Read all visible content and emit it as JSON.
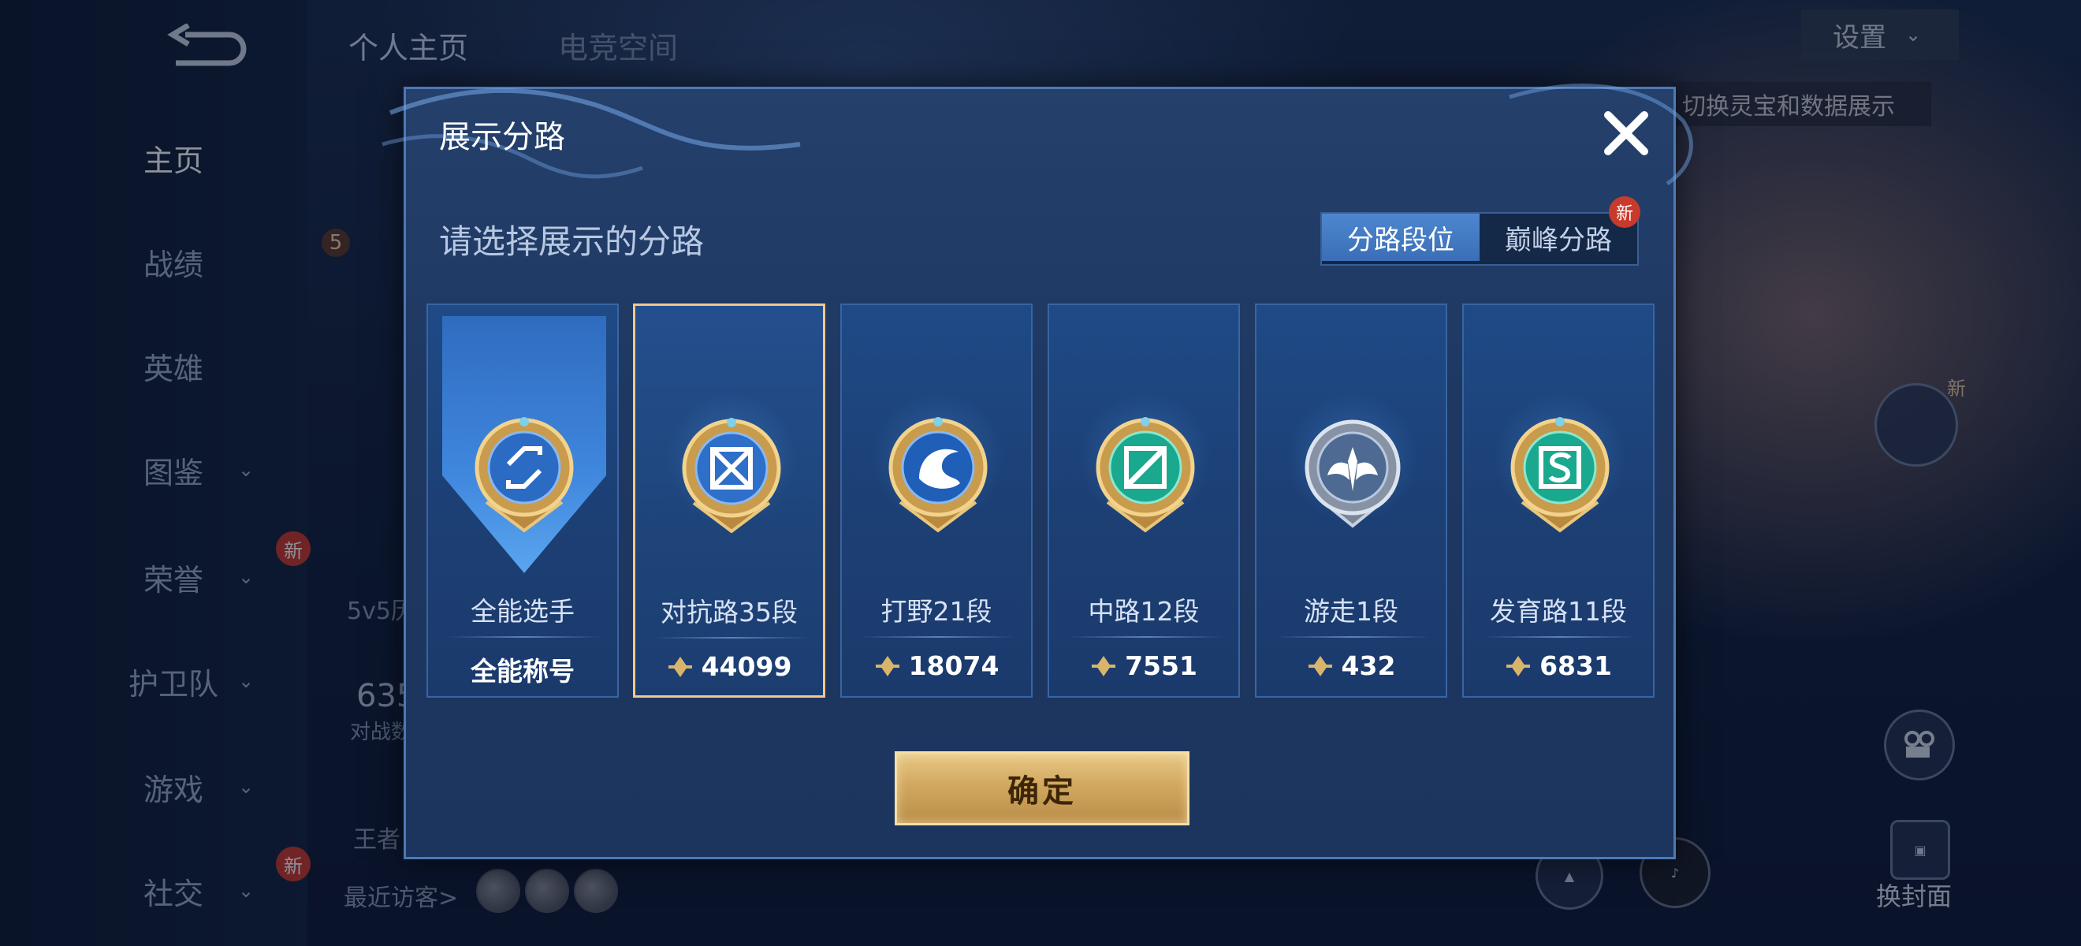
{
  "background": {
    "nav": {
      "items": [
        {
          "label": "主页",
          "has_chevron": false,
          "active": true,
          "new": false
        },
        {
          "label": "战绩",
          "has_chevron": false,
          "active": false,
          "new": false
        },
        {
          "label": "英雄",
          "has_chevron": false,
          "active": false,
          "new": false
        },
        {
          "label": "图鉴",
          "has_chevron": true,
          "active": false,
          "new": false
        },
        {
          "label": "荣誉",
          "has_chevron": true,
          "active": false,
          "new": true
        },
        {
          "label": "护卫队",
          "has_chevron": true,
          "active": false,
          "new": false
        },
        {
          "label": "游戏",
          "has_chevron": true,
          "active": false,
          "new": false
        },
        {
          "label": "社交",
          "has_chevron": true,
          "active": false,
          "new": true
        }
      ],
      "chevron": "⌄",
      "new_badge": "新"
    },
    "top_tabs": [
      "个人主页",
      "电竞空间"
    ],
    "settings": {
      "label": "设置",
      "chevron": "⌄"
    },
    "hint": "切换灵宝和数据展示",
    "fragments": {
      "level": "5",
      "mode": "5v5历",
      "count": "635",
      "count_label": "对战数",
      "king": "王者",
      "recent_visitors": "最近访客>",
      "side_new": "新",
      "cover_label": "换封面"
    }
  },
  "dialog": {
    "title": "展示分路",
    "close_icon": "close-icon",
    "subtitle": "请选择展示的分路",
    "segments": [
      {
        "label": "分路段位",
        "active": true,
        "new": false
      },
      {
        "label": "巅峰分路",
        "active": false,
        "new": true
      }
    ],
    "new_badge": "新",
    "cards": [
      {
        "name": "全能选手",
        "score": "全能称号",
        "selected": false,
        "badge": "all-round-badge-icon",
        "points_icon": false
      },
      {
        "name": "对抗路35段",
        "score": "44099",
        "selected": true,
        "badge": "clash-lane-badge-icon",
        "points_icon": true
      },
      {
        "name": "打野21段",
        "score": "18074",
        "selected": false,
        "badge": "jungle-badge-icon",
        "points_icon": true
      },
      {
        "name": "中路12段",
        "score": "7551",
        "selected": false,
        "badge": "mid-lane-badge-icon",
        "points_icon": true
      },
      {
        "name": "游走1段",
        "score": "432",
        "selected": false,
        "badge": "roam-badge-icon",
        "points_icon": true
      },
      {
        "name": "发育路11段",
        "score": "6831",
        "selected": false,
        "badge": "farm-lane-badge-icon",
        "points_icon": true
      }
    ],
    "confirm_label": "确定"
  },
  "colors": {
    "accent_gold": "#d2a860",
    "dialog_bg": "#1e3862",
    "active_segment": "#4d86cf",
    "badge_red": "#c83a2c"
  }
}
